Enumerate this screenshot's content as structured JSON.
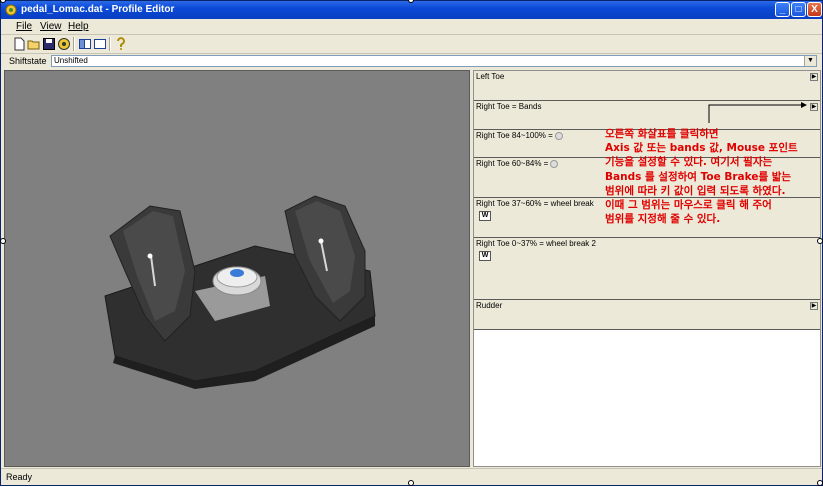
{
  "window": {
    "title": "pedal_Lomac.dat - Profile Editor",
    "title_icon": "profile-editor-app-icon",
    "controls": {
      "minimize": "_",
      "maximize": "□",
      "close": "X"
    }
  },
  "menu": [
    {
      "label": "File"
    },
    {
      "label": "View"
    },
    {
      "label": "Help"
    }
  ],
  "toolbar": {
    "icons": [
      "new-file-icon",
      "open-folder-icon",
      "save-icon",
      "target-icon",
      "layout-split-icon",
      "layout-single-icon",
      "help-tool-icon"
    ]
  },
  "shiftstate": {
    "label": "Shiftstate",
    "value": "Unshifted"
  },
  "rows": [
    {
      "label": "Left Toe",
      "has_arrow": true
    },
    {
      "label": "Right Toe = Bands",
      "has_arrow": true
    },
    {
      "label": "Right Toe 84~100% ="
    },
    {
      "label": "Right Toe 60~84% ="
    },
    {
      "label": "Right Toe 37~60% = wheel break",
      "button": "W"
    },
    {
      "label": "Right Toe 0~37% = wheel break 2",
      "button": "W"
    },
    {
      "label": "Rudder",
      "has_arrow": true
    }
  ],
  "annotation": {
    "lines": [
      "오른쪽 화살표를 클릭하면",
      "Axis 값 또는 bands 값, Mouse 포인트",
      "기능을 설정할 수 있다. 여기서 필자는",
      "Bands 를 설정하여 Toe Brake를 밟는",
      "범위에 따라 키 값이 입력 되도록 하였다.",
      "이때 그 범위는 마우스로 클릭 해 주어",
      "범위를 지정해 줄 수 있다."
    ],
    "color": "#e00000"
  },
  "status": {
    "text": "Ready"
  }
}
